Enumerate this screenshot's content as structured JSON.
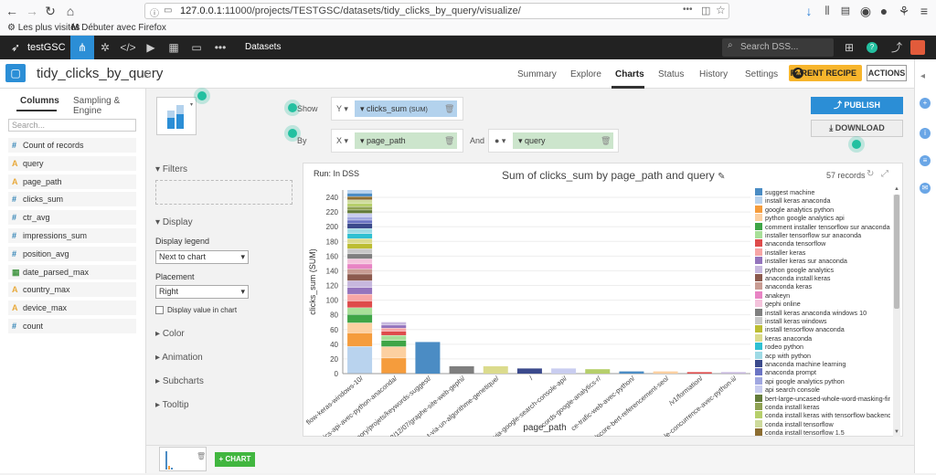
{
  "browser": {
    "url_host": "127.0.0.1",
    "url_path": ":11000/projects/TESTGSC/datasets/tidy_clicks_by_query/visualize/",
    "bookmarks": [
      "Les plus visités",
      "Débuter avec Firefox"
    ],
    "menu_dots": "•••"
  },
  "topbar": {
    "project": "testGSC",
    "section": "Datasets",
    "search_placeholder": "Search DSS..."
  },
  "header": {
    "dataset_title": "tidy_clicks_by_query",
    "tabs": [
      "Summary",
      "Explore",
      "Charts",
      "Status",
      "History",
      "Settings"
    ],
    "active_tab": "Charts",
    "parent_recipe": "PARENT RECIPE",
    "actions": "ACTIONS"
  },
  "sidebar": {
    "tabs": [
      "Columns",
      "Sampling & Engine"
    ],
    "search_placeholder": "Search...",
    "columns": [
      {
        "type": "#",
        "name": "Count of records"
      },
      {
        "type": "A",
        "name": "query"
      },
      {
        "type": "A",
        "name": "page_path"
      },
      {
        "type": "#",
        "name": "clicks_sum"
      },
      {
        "type": "#",
        "name": "ctr_avg"
      },
      {
        "type": "#",
        "name": "impressions_sum"
      },
      {
        "type": "#",
        "name": "position_avg"
      },
      {
        "type": "D",
        "name": "date_parsed_max"
      },
      {
        "type": "A",
        "name": "country_max"
      },
      {
        "type": "A",
        "name": "device_max"
      },
      {
        "type": "#",
        "name": "count"
      }
    ]
  },
  "shelves": {
    "show_label": "Show",
    "by_label": "By",
    "y_axis": "Y",
    "x_axis": "X",
    "y_measure": "clicks_sum",
    "y_agg": "(SUM)",
    "x_dimension": "page_path",
    "and_label": "And",
    "color_dimension": "query"
  },
  "buttons": {
    "publish": "PUBLISH",
    "download": "DOWNLOAD",
    "add_chart": "+ CHART"
  },
  "options": {
    "filters": "Filters",
    "display": "Display",
    "display_legend_label": "Display legend",
    "display_legend_value": "Next to chart",
    "placement_label": "Placement",
    "placement_value": "Right",
    "display_value_label": "Display value in chart",
    "color": "Color",
    "animation": "Animation",
    "subcharts": "Subcharts",
    "tooltip": "Tooltip"
  },
  "chart_meta": {
    "run_info": "Run: In DSS",
    "records": "57 records"
  },
  "chart_data": {
    "type": "bar",
    "stacked": true,
    "title": "Sum of clicks_sum by page_path and query",
    "ylabel": "clicks_sum (SUM)",
    "xlabel": "page_path",
    "ylim": [
      0,
      250
    ],
    "yticks": [
      0,
      20,
      40,
      60,
      80,
      100,
      120,
      140,
      160,
      180,
      200,
      220,
      240
    ],
    "legend_position": "right",
    "categories": [
      "flow-keras-windows-10/",
      "ics-api-avec-python-anaconda/",
      "mory/projets/keywords-suggest/",
      "2/12/07/graphe-site-web-gephi/",
      "t-via-un-algorithme-genetique/",
      "/",
      "-via-google-search-console-api/",
      "cords-google-analytics-r/",
      "ce-trafic-web-avec-python/",
      "/score-bert-referencement-seo/",
      "/v1/formation/",
      "le-concurrence-avec-python-ii/"
    ],
    "totals": [
      250,
      70,
      43,
      10,
      10,
      7,
      7,
      6,
      3,
      3,
      2,
      2
    ],
    "legend": [
      {
        "name": "suggest machine",
        "color": "#4b8cc4"
      },
      {
        "name": "install keras anaconda",
        "color": "#b9d3ee"
      },
      {
        "name": "google analytics python",
        "color": "#f59c3c"
      },
      {
        "name": "python google analytics api",
        "color": "#fcd0a1"
      },
      {
        "name": "comment installer tensorflow sur anaconda",
        "color": "#3fa547"
      },
      {
        "name": "installer tensorflow sur anaconda",
        "color": "#a8df98"
      },
      {
        "name": "anaconda tensorflow",
        "color": "#de4b4b"
      },
      {
        "name": "installer keras",
        "color": "#f7a6a6"
      },
      {
        "name": "installer keras sur anaconda",
        "color": "#9474bd"
      },
      {
        "name": "python google analytics",
        "color": "#c7b8de"
      },
      {
        "name": "anaconda install keras",
        "color": "#8c5a4e"
      },
      {
        "name": "anaconda keras",
        "color": "#c89c93"
      },
      {
        "name": "anakeyn",
        "color": "#e884c4"
      },
      {
        "name": "gephi online",
        "color": "#f4c3dc"
      },
      {
        "name": "install keras anaconda windows 10",
        "color": "#7f7f7f"
      },
      {
        "name": "install keras windows",
        "color": "#c7c7c7"
      },
      {
        "name": "install tensorflow anaconda",
        "color": "#bcbd32"
      },
      {
        "name": "keras anaconda",
        "color": "#dbdb8d"
      },
      {
        "name": "rodeo python",
        "color": "#2fc0d2"
      },
      {
        "name": "acp with python",
        "color": "#9edae5"
      },
      {
        "name": "anaconda machine learning",
        "color": "#3b4a8c"
      },
      {
        "name": "anaconda prompt",
        "color": "#6b74c4"
      },
      {
        "name": "api google analytics python",
        "color": "#a0a7e0"
      },
      {
        "name": "api search console",
        "color": "#c9cdf0"
      },
      {
        "name": "bert-large-uncased-whole-word-masking-finetuned-squad",
        "color": "#637b39"
      },
      {
        "name": "conda install keras",
        "color": "#8ea152"
      },
      {
        "name": "conda install keras with tensorflow backend",
        "color": "#b6cf6b"
      },
      {
        "name": "conda install tensorflow",
        "color": "#cedb9c"
      },
      {
        "name": "conda install tensorflow 1.5",
        "color": "#8c6d31"
      }
    ]
  }
}
